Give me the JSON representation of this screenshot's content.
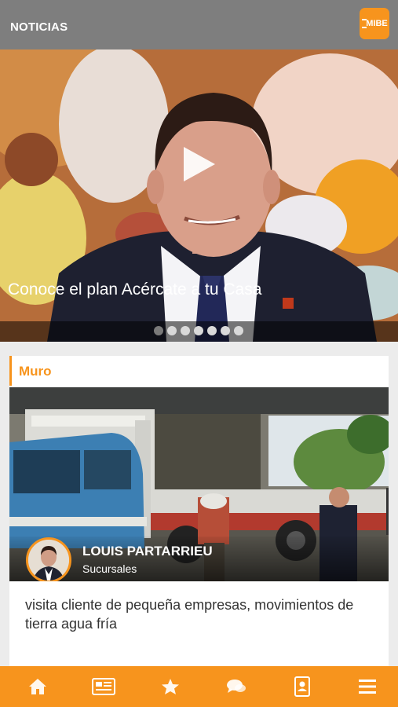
{
  "header": {
    "title": "NOTICIAS",
    "logo_text": "MIBE"
  },
  "hero": {
    "caption": "Conoce el plan Acércate a tu Casa",
    "slides_total": 7,
    "active_slide": 1
  },
  "wall": {
    "title": "Muro",
    "post": {
      "author_name": "LOUIS PARTARRIEU",
      "author_role": "Sucursales",
      "text": "visita cliente de pequeña empresas, movimientos de tierra agua fría"
    }
  },
  "bottom_nav": {
    "items": [
      "home-icon",
      "newspaper-icon",
      "star-icon",
      "chat-icon",
      "contacts-icon",
      "menu-icon"
    ]
  },
  "colors": {
    "accent": "#f7941d",
    "header_bg": "#7e7e7e"
  }
}
